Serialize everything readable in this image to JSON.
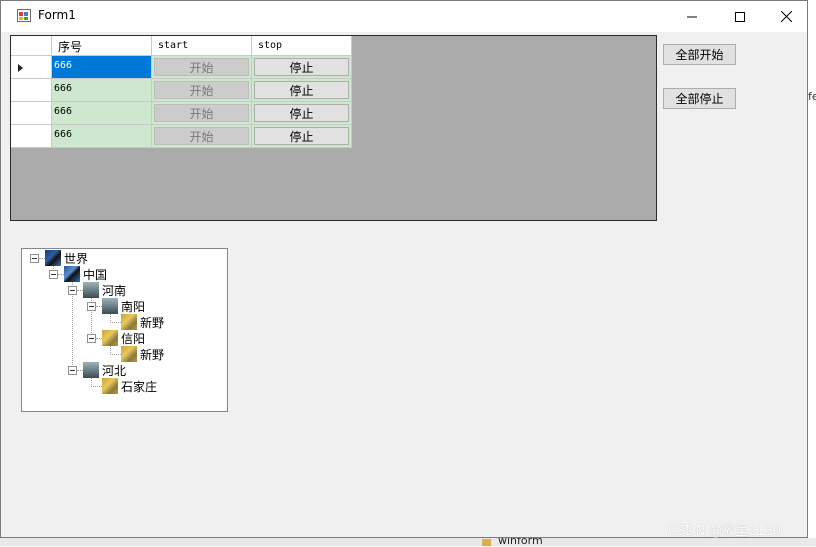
{
  "window": {
    "title": "Form1"
  },
  "grid": {
    "columns": [
      "序号",
      "start",
      "stop"
    ],
    "rows": [
      {
        "id": "666",
        "start": "开始",
        "stop": "停止",
        "selected": true
      },
      {
        "id": "666",
        "start": "开始",
        "stop": "停止",
        "selected": false
      },
      {
        "id": "666",
        "start": "开始",
        "stop": "停止",
        "selected": false
      },
      {
        "id": "666",
        "start": "开始",
        "stop": "停止",
        "selected": false
      }
    ],
    "row_color": "#cde8ce",
    "selected_color": "#0078d7"
  },
  "buttons": {
    "start_all": "全部开始",
    "stop_all": "全部停止"
  },
  "tree": {
    "world": "世界",
    "china": "中国",
    "henan": "河南",
    "nanyang": "南阳",
    "xinye_1": "新野",
    "xinyang": "信阳",
    "xinye_2": "新野",
    "hebei": "河北",
    "shijiazhuang": "石家庄"
  },
  "background": {
    "folder_label": "winform",
    "fragment": "fe"
  },
  "watermark": "CSDN @故里2130"
}
